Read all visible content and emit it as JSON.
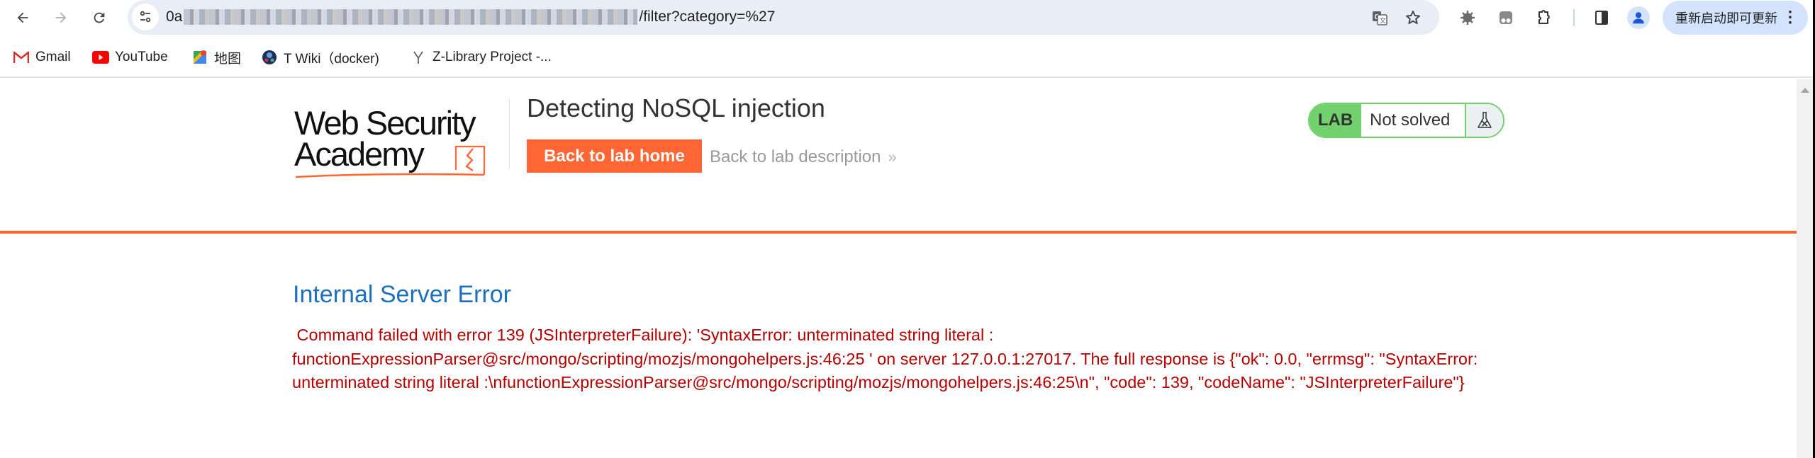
{
  "browser": {
    "nav": {
      "back_icon": "arrow-left-icon",
      "forward_icon": "arrow-right-icon",
      "reload_icon": "reload-icon"
    },
    "omnibox": {
      "url_prefix": "0a",
      "url_suffix": "/filter?category=%27",
      "site_info_icon": "tune-icon",
      "translate_icon": "translate-icon",
      "bookmark_icon": "star-icon"
    },
    "extensions": [
      "bug-extension-icon",
      "tampermonkey-icon",
      "puzzle-extensions-icon"
    ],
    "side_panel_icon": "side-panel-icon",
    "profile_icon": "profile-avatar-icon",
    "update_label": "重新启动即可更新",
    "menu_icon": "kebab-menu-icon"
  },
  "bookmarks": [
    {
      "label": "Gmail",
      "icon": "gmail-icon"
    },
    {
      "label": "YouTube",
      "icon": "youtube-icon"
    },
    {
      "label": "地图",
      "icon": "maps-icon"
    },
    {
      "label": "T Wiki（docker)",
      "icon": "globe-icon"
    },
    {
      "label": "Z-Library Project -...",
      "icon": "zlibrary-icon"
    }
  ],
  "header": {
    "logo_line1": "Web Security",
    "logo_line2": "Academy",
    "lab_title": "Detecting NoSQL injection",
    "back_home_label": "Back to lab home",
    "back_description_label": "Back to lab description",
    "back_description_chevron": "»",
    "lab_badge": {
      "tag": "LAB",
      "status": "Not solved",
      "icon": "flask-icon"
    }
  },
  "colors": {
    "accent": "#ff6633",
    "lab_green": "#70d16d",
    "error_title": "#1d6fbf",
    "error_text": "#b50000"
  },
  "main": {
    "error_title": "Internal Server Error",
    "error_message": " Command failed with error 139 (JSInterpreterFailure): 'SyntaxError: unterminated string literal :\nfunctionExpressionParser@src/mongo/scripting/mozjs/mongohelpers.js:46:25 ' on server 127.0.0.1:27017. The full response is {\"ok\": 0.0, \"errmsg\": \"SyntaxError:\nunterminated string literal :\\nfunctionExpressionParser@src/mongo/scripting/mozjs/mongohelpers.js:46:25\\n\", \"code\": 139, \"codeName\": \"JSInterpreterFailure\"}",
    "error_lines": [
      " Command failed with error 139 (JSInterpreterFailure): 'SyntaxError: unterminated string literal :",
      "functionExpressionParser@src/mongo/scripting/mozjs/mongohelpers.js:46:25 ' on server 127.0.0.1:27017. The full response is {\"ok\": 0.0, \"errmsg\": \"SyntaxError:",
      "unterminated string literal :\\nfunctionExpressionParser@src/mongo/scripting/mozjs/mongohelpers.js:46:25\\n\", \"code\": 139, \"codeName\": \"JSInterpreterFailure\"}"
    ]
  }
}
